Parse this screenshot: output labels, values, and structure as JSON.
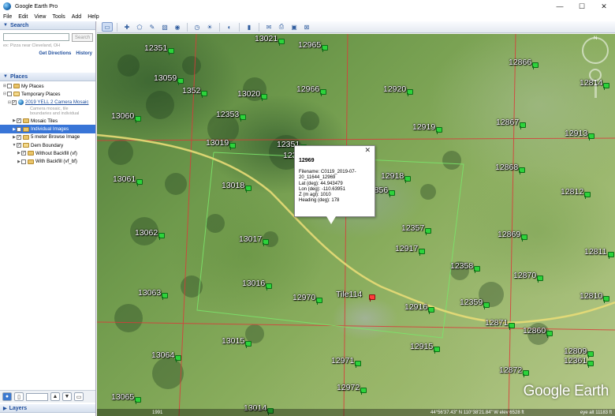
{
  "window": {
    "title": "Google Earth Pro",
    "controls": [
      "—",
      "☐",
      "✕"
    ]
  },
  "menu": [
    "File",
    "Edit",
    "View",
    "Tools",
    "Add",
    "Help"
  ],
  "search": {
    "header": "Search",
    "placeholder": "",
    "button": "Search",
    "hint": "ex: Pizza near Cleveland, OH",
    "get_directions": "Get Directions",
    "history": "History"
  },
  "places": {
    "header": "Places",
    "items": [
      {
        "label": "My Places"
      },
      {
        "label": "Temporary Places"
      },
      {
        "label": "2019 YELL 2 Camera Mosaic"
      },
      {
        "label": "Mosaic Tiles"
      },
      {
        "label": "Individual Images"
      },
      {
        "label": "5 meter Browse Image"
      },
      {
        "label": "Dem Boundary"
      },
      {
        "label": "Without Backfill (vf)"
      },
      {
        "label": "With Backfill (vf_bf)"
      }
    ],
    "description_lines": [
      "Camera mosaic, tile",
      "boundaries and individual"
    ]
  },
  "layers": {
    "header": "Layers"
  },
  "balloon": {
    "title": "12969",
    "filename": "Filename: C0119_2019-07-",
    "filename_cont": "20_11644_12969",
    "lat": "Lat (deg): 44.943479",
    "lon": "Lon (deg): -110.63951",
    "z": "Z (m agl): 1010",
    "heading": "Heading (deg): 178",
    "close": "✕"
  },
  "map_labels": [
    "13021",
    "12965",
    "12866",
    "12351",
    "13059",
    "1352",
    "13020",
    "12966",
    "12920",
    "12814",
    "13060",
    "12353",
    "12919",
    "12867",
    "12913",
    "13019",
    "12351",
    "1235",
    "12918",
    "12868",
    "13061",
    "13018",
    "12856",
    "12812",
    "12357",
    "13062",
    "13017",
    "12917",
    "12869",
    "12811",
    "12358",
    "12870",
    "13016",
    "13063",
    "12970",
    "Tile114",
    "12916",
    "12359",
    "12810",
    "12871",
    "12860",
    "13015",
    "12915",
    "12809",
    "13064",
    "12971",
    "12361",
    "12872",
    "12972",
    "13065",
    "13014"
  ],
  "status": {
    "tour_label": "1991",
    "coords": "44°56'37.43\" N  110°38'21.84\" W  elev 6528 ft",
    "eye": "eye alt 11183 ft"
  },
  "watermark": "Google Earth",
  "compass_n": "N",
  "colors": {
    "accent": "#1f4e9c",
    "selection": "#3875d7",
    "pin": "#2dd33b",
    "grid_red": "#d93b3b",
    "grid_green": "#7be36a",
    "road": "#e8dc77"
  }
}
